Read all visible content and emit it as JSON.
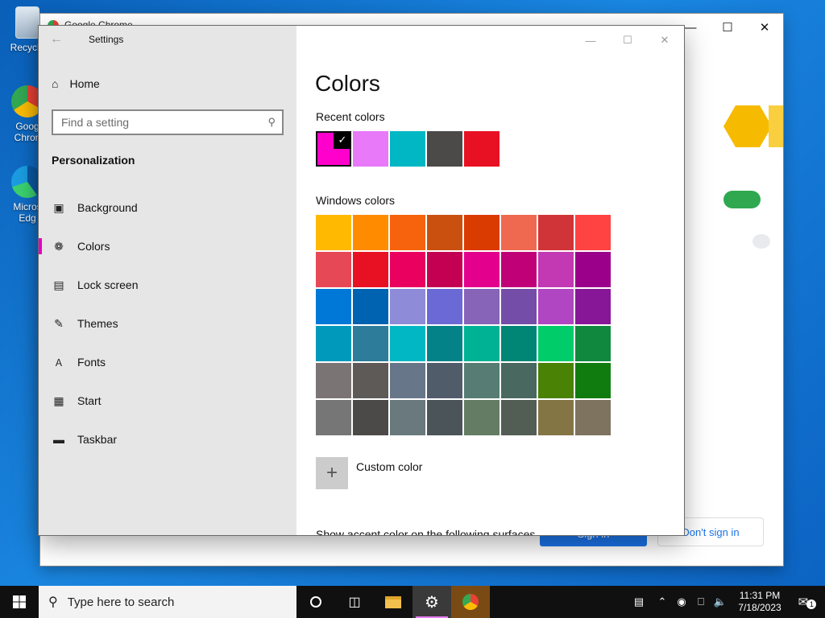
{
  "desktop": {
    "icons": [
      {
        "label": "Recycle"
      },
      {
        "label": "Goog Chron"
      },
      {
        "label": "Micros Edg"
      }
    ]
  },
  "chrome_window": {
    "title": "Google Chrome",
    "sign_in_label": "Sign in",
    "dont_sign_in_label": "Don't sign in"
  },
  "settings": {
    "window_title": "Settings",
    "home_label": "Home",
    "search": {
      "placeholder": "Find a setting"
    },
    "section": "Personalization",
    "nav_items": [
      {
        "label": "Background",
        "icon": "image-icon"
      },
      {
        "label": "Colors",
        "icon": "palette-icon",
        "active": true
      },
      {
        "label": "Lock screen",
        "icon": "lock-screen-icon"
      },
      {
        "label": "Themes",
        "icon": "brush-icon"
      },
      {
        "label": "Fonts",
        "icon": "font-icon"
      },
      {
        "label": "Start",
        "icon": "start-grid-icon"
      },
      {
        "label": "Taskbar",
        "icon": "taskbar-icon"
      }
    ],
    "page_title": "Colors",
    "recent_colors_label": "Recent colors",
    "recent_colors": [
      "#ff00cc",
      "#e879f9",
      "#00b7c3",
      "#4c4a48",
      "#e81123"
    ],
    "selected_recent_index": 0,
    "windows_colors_label": "Windows colors",
    "windows_colors": [
      [
        "#ffb900",
        "#ff8c00",
        "#f7630c",
        "#ca5010",
        "#da3b01",
        "#ef6950",
        "#d13438",
        "#ff4343"
      ],
      [
        "#e74856",
        "#e81123",
        "#ea005e",
        "#c30052",
        "#e3008c",
        "#bf0077",
        "#c239b3",
        "#9a0089"
      ],
      [
        "#0078d7",
        "#0063b1",
        "#8e8cd8",
        "#6b69d6",
        "#8764b8",
        "#744da9",
        "#b146c2",
        "#881798"
      ],
      [
        "#0099bc",
        "#2d7d9a",
        "#00b7c3",
        "#038387",
        "#00b294",
        "#018574",
        "#00cc6a",
        "#10893e"
      ],
      [
        "#7a7574",
        "#5d5a58",
        "#68768a",
        "#515c6b",
        "#567c73",
        "#486860",
        "#498205",
        "#107c10"
      ],
      [
        "#767676",
        "#4c4a48",
        "#69797e",
        "#4a5459",
        "#647c64",
        "#525e54",
        "#847545",
        "#7e735f"
      ]
    ],
    "custom_color_label": "Custom color",
    "cut_off_text": "Show accent color on the following surfaces"
  },
  "taskbar": {
    "search_placeholder": "Type here to search",
    "time": "11:31 PM",
    "date": "7/18/2023",
    "notification_count": "1"
  }
}
